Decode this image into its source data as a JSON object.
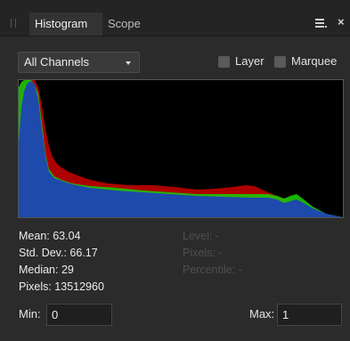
{
  "tabs": [
    {
      "label": "Histogram",
      "active": true
    },
    {
      "label": "Scope",
      "active": false
    }
  ],
  "channel_select": {
    "value": "All Channels"
  },
  "options": {
    "layer_label": "Layer",
    "marquee_label": "Marquee"
  },
  "stats": {
    "mean": "Mean: 63.04",
    "std_dev": "Std. Dev.: 66.17",
    "median": "Median: 29",
    "pixels": "Pixels: 13512960",
    "level": "Level: -",
    "cursor_pixels": "Pixels: -",
    "percentile": "Percentile: -"
  },
  "range": {
    "min_label": "Min:",
    "min_value": "0",
    "max_label": "Max:",
    "max_value": "1"
  },
  "colors": {
    "red_channel": "#c00000",
    "green_channel": "#19c800",
    "blue_channel": "#1e44b4",
    "panel_bg": "#2b2b2b"
  }
}
